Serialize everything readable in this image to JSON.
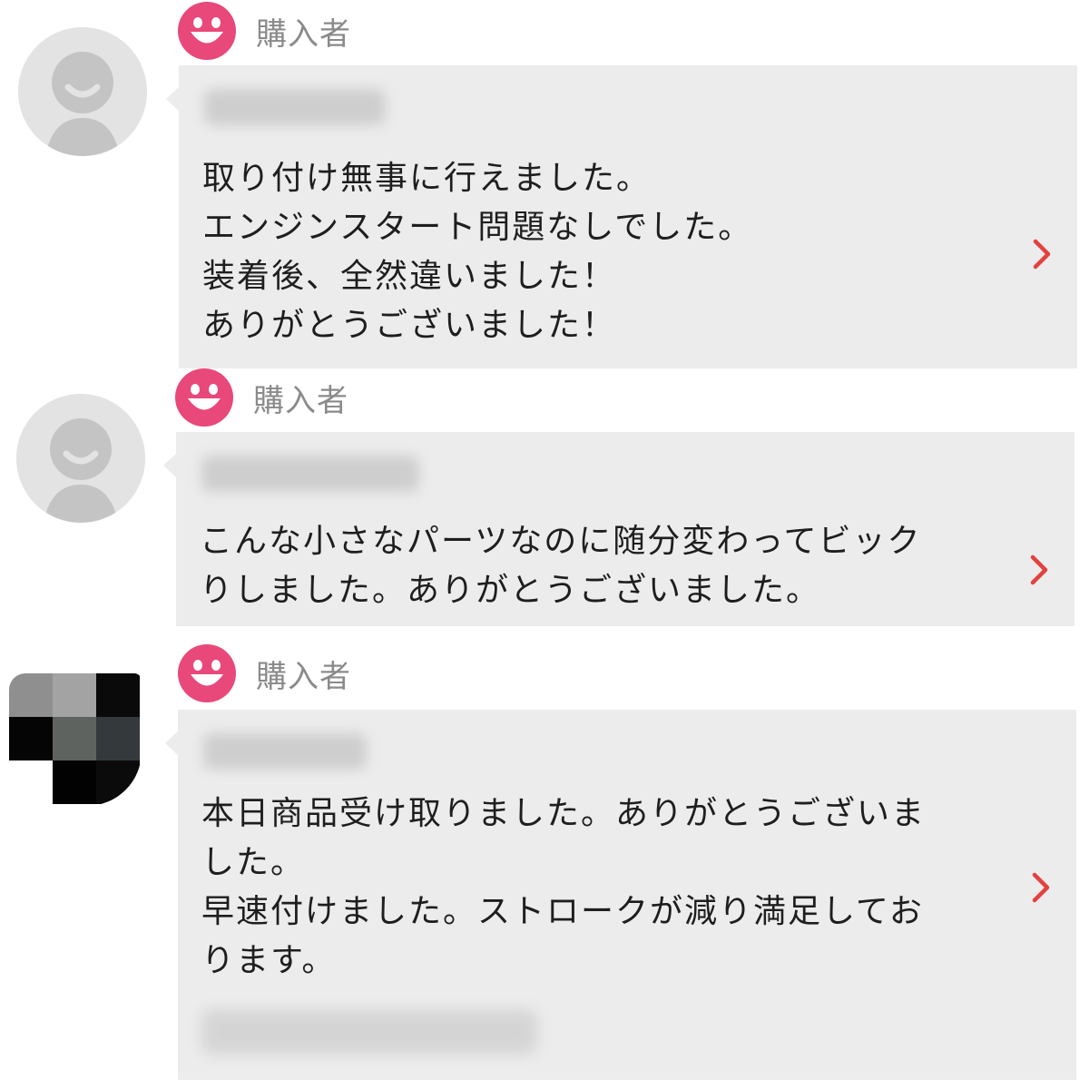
{
  "reviews": [
    {
      "role_label": "購入者",
      "lines": [
        "取り付け無事に行えました。",
        "エンジンスタート問題なしでした。",
        "装着後、全然違いました！",
        "ありがとうございました！"
      ]
    },
    {
      "role_label": "購入者",
      "lines": [
        "こんな小さなパーツなのに随分変わってビック",
        "りしました。ありがとうございました。"
      ]
    },
    {
      "role_label": "購入者",
      "lines": [
        "本日商品受け取りました。ありがとうございま",
        "した。",
        "早速付けました。ストロークが減り満足してお",
        "ります。"
      ]
    }
  ],
  "colors": {
    "accent": "#e8487a",
    "bubble": "#ececec",
    "role_text": "#8a8a8a",
    "chevron": "#e4403f"
  },
  "icons": {
    "avatar": "default-user-avatar-icon",
    "badge": "smiley-face-icon",
    "chevron": "chevron-right-icon"
  }
}
